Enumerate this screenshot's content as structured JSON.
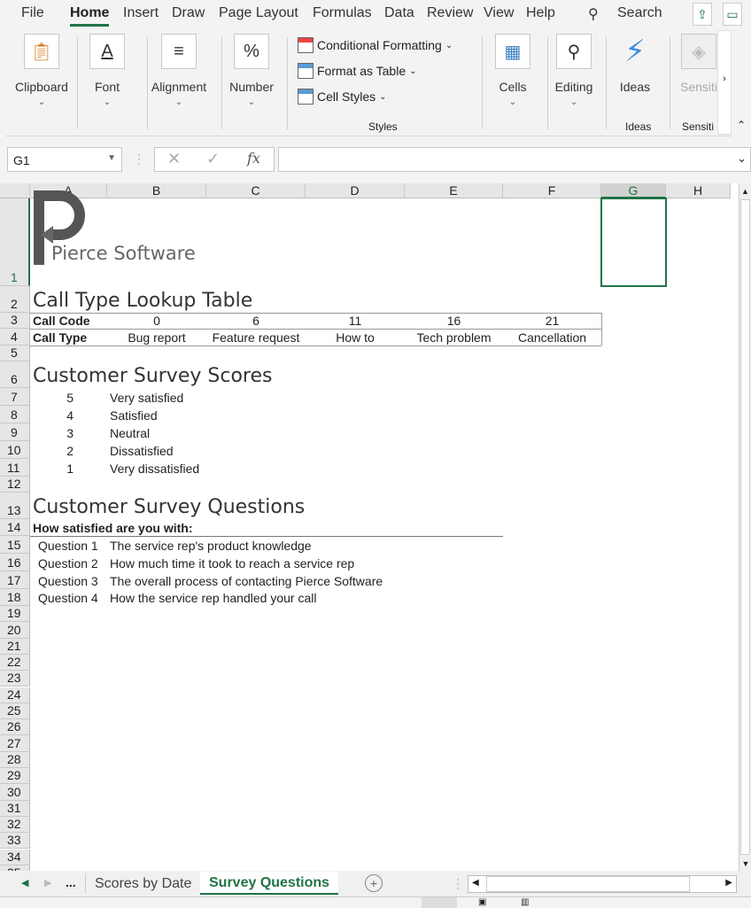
{
  "tabs": [
    "File",
    "Home",
    "Insert",
    "Draw",
    "Page Layout",
    "Formulas",
    "Data",
    "Review",
    "View",
    "Help"
  ],
  "search_label": "Search",
  "ribbon": {
    "groups": [
      "Clipboard",
      "Font",
      "Alignment",
      "Number",
      "Cells",
      "Editing",
      "Ideas",
      "Sensiti"
    ],
    "styles": [
      "Conditional Formatting",
      "Format as Table",
      "Cell Styles"
    ],
    "styles_label": "Styles",
    "ideas_label": "Ideas",
    "sens_label": "Sensiti"
  },
  "name_box": "G1",
  "fx": "fx",
  "columns": [
    "A",
    "B",
    "C",
    "D",
    "E",
    "F",
    "G",
    "H"
  ],
  "selected_cell": "G1",
  "logo_text": "Pierce Software",
  "lookup": {
    "title": "Call Type Lookup Table",
    "code_label": "Call Code",
    "type_label": "Call Type",
    "codes": [
      "0",
      "6",
      "11",
      "16",
      "21"
    ],
    "types": [
      "Bug report",
      "Feature request",
      "How to",
      "Tech problem",
      "Cancellation"
    ]
  },
  "scores": {
    "title": "Customer Survey Scores",
    "items": [
      {
        "n": "5",
        "t": "Very satisfied"
      },
      {
        "n": "4",
        "t": "Satisfied"
      },
      {
        "n": "3",
        "t": "Neutral"
      },
      {
        "n": "2",
        "t": "Dissatisfied"
      },
      {
        "n": "1",
        "t": "Very dissatisfied"
      }
    ]
  },
  "questions": {
    "title": "Customer Survey Questions",
    "subtitle": "How satisfied are you with:",
    "items": [
      {
        "q": "Question 1",
        "t": "The service rep's product knowledge"
      },
      {
        "q": "Question 2",
        "t": "How much time it took to reach a service rep"
      },
      {
        "q": "Question 3",
        "t": "The overall process of contacting Pierce Software"
      },
      {
        "q": "Question 4",
        "t": "How the service rep handled your call"
      }
    ]
  },
  "sheets": {
    "more": "...",
    "items": [
      "Scores by Date",
      "Survey Questions"
    ],
    "active": "Survey Questions"
  },
  "accent": "#217346"
}
